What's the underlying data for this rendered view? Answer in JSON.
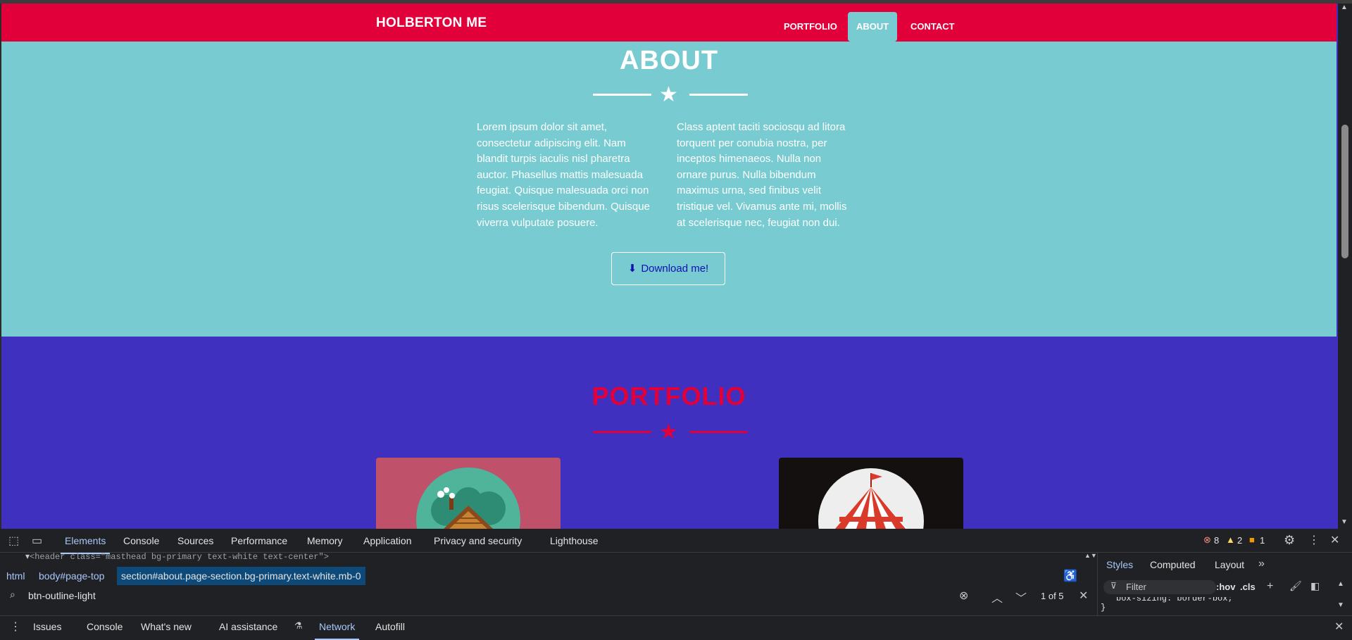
{
  "navbar": {
    "brand": "HOLBERTON ME",
    "items": [
      {
        "label": "PORTFOLIO",
        "active": false
      },
      {
        "label": "ABOUT",
        "active": true
      },
      {
        "label": "CONTACT",
        "active": false
      }
    ]
  },
  "about": {
    "title": "ABOUT",
    "paragraph_left": "Lorem ipsum dolor sit amet, consectetur adipiscing elit. Nam blandit turpis iaculis nisl pharetra auctor. Phasellus mattis malesuada feugiat. Quisque malesuada orci non risus scelerisque bibendum. Quisque viverra vulputate posuere.",
    "paragraph_right": "Class aptent taciti sociosqu ad litora torquent per conubia nostra, per inceptos himenaeos. Nulla non ornare purus. Nulla bibendum maximus urna, sed finibus velit tristique vel. Vivamus ante mi, mollis at scelerisque nec, feugiat non dui.",
    "download_label": "Download me!"
  },
  "portfolio": {
    "title": "PORTFOLIO",
    "cards": [
      {
        "icon": "cabin-icon",
        "bg": "#c0516a"
      },
      {
        "icon": "circus-tent-icon",
        "bg": "#141010"
      }
    ]
  },
  "colors": {
    "navbar": "#e2003b",
    "about_bg": "#78cbd0",
    "portfolio_bg": "#4030c0",
    "accent": "#e2003b"
  },
  "devtools": {
    "tabs": [
      "Elements",
      "Console",
      "Sources",
      "Performance",
      "Memory",
      "Application",
      "Privacy and security",
      "Lighthouse"
    ],
    "active_tab": "Elements",
    "error_count": "8",
    "warning_count": "2",
    "info_count": "1",
    "dom_line": "<header class=\"masthead bg-primary text-white text-center\">",
    "breadcrumbs": [
      "html",
      "body#page-top",
      "section#about.page-section.bg-primary.text-white.mb-0"
    ],
    "search_value": "btn-outline-light",
    "search_result": "1 of 5",
    "styles_tabs": [
      "Styles",
      "Computed",
      "Layout"
    ],
    "filter_placeholder": "Filter",
    "hov_label": ":hov",
    "cls_label": ".cls",
    "style_line": "box-sizing: border-box;",
    "style_close": "}",
    "drawer_tabs": [
      "Issues",
      "Console",
      "What's new",
      "AI assistance",
      "Network",
      "Autofill"
    ],
    "drawer_active": "Network"
  }
}
